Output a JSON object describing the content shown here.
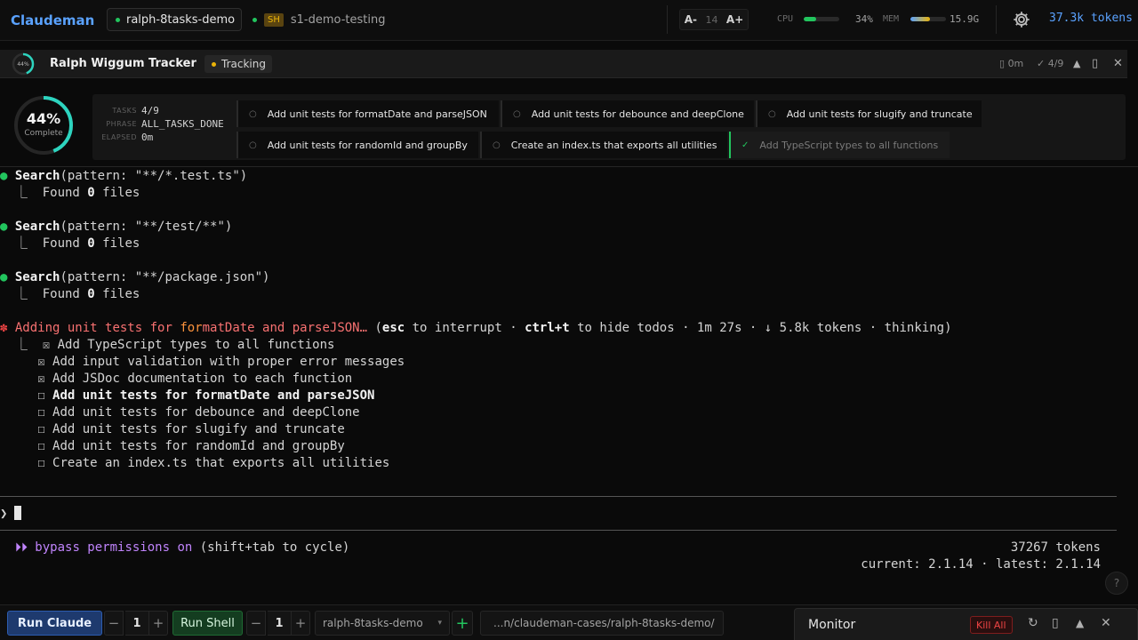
{
  "topbar": {
    "brand": "Claudeman",
    "tabs": [
      {
        "label": "ralph-8tasks-demo",
        "active": true
      },
      {
        "label": "s1-demo-testing",
        "badge": "SH",
        "active": false
      }
    ],
    "font": {
      "decrease": "A-",
      "size": "14",
      "increase": "A+"
    },
    "cpu": {
      "label": "CPU",
      "value": "34%",
      "fraction": 0.34
    },
    "mem": {
      "label": "MEM",
      "value": "15.9G",
      "fraction": 0.55
    },
    "tokens": "37.3k tokens"
  },
  "tracker": {
    "mini_percent_label": "44%",
    "percent": 44,
    "title": "Ralph Wiggum Tracker",
    "status": "Tracking",
    "elapsed": "0m",
    "progress": "✓ 4/9"
  },
  "panel": {
    "percent_label": "44%",
    "complete_label": "Complete",
    "meta": [
      {
        "key": "TASKS",
        "value": "4/9"
      },
      {
        "key": "PHRASE",
        "value": "ALL_TASKS_DONE"
      },
      {
        "key": "ELAPSED",
        "value": "0m"
      }
    ],
    "tasks": [
      {
        "label": "Add unit tests for formatDate and parseJSON",
        "done": false
      },
      {
        "label": "Add unit tests for debounce and deepClone",
        "done": false
      },
      {
        "label": "Add unit tests for slugify and truncate",
        "done": false
      },
      {
        "label": "Add unit tests for randomId and groupBy",
        "done": false
      },
      {
        "label": "Create an index.ts that exports all utilities",
        "done": false
      },
      {
        "label": "Add TypeScript types to all functions",
        "done": true
      }
    ]
  },
  "terminal": {
    "searches": [
      {
        "tool": "Search",
        "args": "(pattern: \"**/*.test.ts\")",
        "result_pre": "  Found ",
        "count": "0",
        "result_post": " files"
      },
      {
        "tool": "Search",
        "args": "(pattern: \"**/test/**\")",
        "result_pre": "  Found ",
        "count": "0",
        "result_post": " files"
      },
      {
        "tool": "Search",
        "args": "(pattern: \"**/package.json\")",
        "result_pre": "  Found ",
        "count": "0",
        "result_post": " files"
      }
    ],
    "activity": {
      "spinner": "✽",
      "text_a": "Adding unit tests for ",
      "text_b": "for",
      "text_c": "matDate and parseJSON…",
      "open": " (",
      "esc": "esc",
      "mid1": " to interrupt · ",
      "ctrlt": "ctrl+t",
      "mid2": " to hide todos · 1m 27s · ↓ 5.8k tokens · thinking)"
    },
    "todos": [
      {
        "box": "☒",
        "text": "Add TypeScript types to all functions",
        "bold": false
      },
      {
        "box": "☒",
        "text": "Add input validation with proper error messages",
        "bold": false
      },
      {
        "box": "☒",
        "text": "Add JSDoc documentation to each function",
        "bold": false
      },
      {
        "box": "☐",
        "text": "Add unit tests for formatDate and parseJSON",
        "bold": true
      },
      {
        "box": "☐",
        "text": "Add unit tests for debounce and deepClone",
        "bold": false
      },
      {
        "box": "☐",
        "text": "Add unit tests for slugify and truncate",
        "bold": false
      },
      {
        "box": "☐",
        "text": "Add unit tests for randomId and groupBy",
        "bold": false
      },
      {
        "box": "☐",
        "text": "Create an index.ts that exports all utilities",
        "bold": false
      }
    ],
    "prompt": "❯",
    "status_bypass": "bypass permissions on",
    "status_cycle": " (shift+tab to cycle)",
    "tokens": "37267 tokens",
    "version": "current: 2.1.14 · latest: 2.1.14",
    "help": "?"
  },
  "bottombar": {
    "run_claude": "Run Claude",
    "claude_count": "1",
    "run_shell": "Run Shell",
    "shell_count": "1",
    "minus": "−",
    "plus": "+",
    "session_select": "ralph-8tasks-demo",
    "path": "...n/claudeman-cases/ralph-8tasks-demo/",
    "monitor_title": "Monitor",
    "kill_all": "Kill All"
  }
}
